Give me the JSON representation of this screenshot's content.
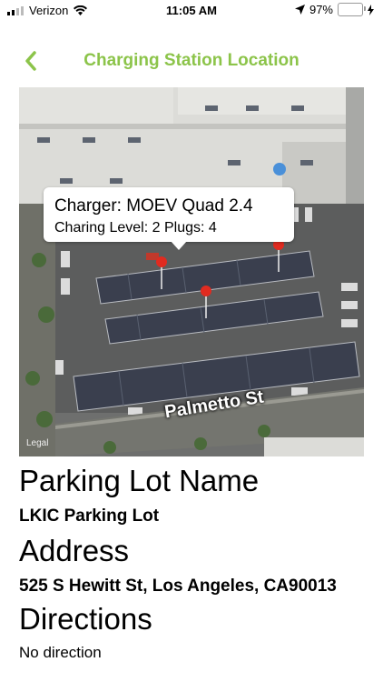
{
  "status_bar": {
    "carrier": "Verizon",
    "time": "11:05 AM",
    "battery": "97%",
    "battery_level": 0.97
  },
  "nav": {
    "back_icon": "chevron-left-icon",
    "title": "Charging Station Location"
  },
  "map": {
    "callout": {
      "title": "Charger: MOEV Quad 2.4",
      "subtitle": "Charing Level: 2 Plugs: 4"
    },
    "street_label": "Palmetto St",
    "legal": "Legal",
    "pins": [
      {
        "icon": "map-pin-icon"
      },
      {
        "icon": "map-pin-icon"
      },
      {
        "icon": "map-pin-icon"
      }
    ],
    "colors": {
      "pin": "#e02b20",
      "roof": "#d9d9d6",
      "solar": "#3b4050",
      "lot": "#5d5e5e"
    }
  },
  "details": {
    "parking_lot_heading": "Parking Lot Name",
    "parking_lot_value": "LKIC Parking Lot",
    "address_heading": "Address",
    "address_value": "525 S Hewitt St, Los Angeles, CA90013",
    "directions_heading": "Directions",
    "directions_value": "No direction"
  },
  "colors": {
    "accent": "#8cc44a"
  }
}
